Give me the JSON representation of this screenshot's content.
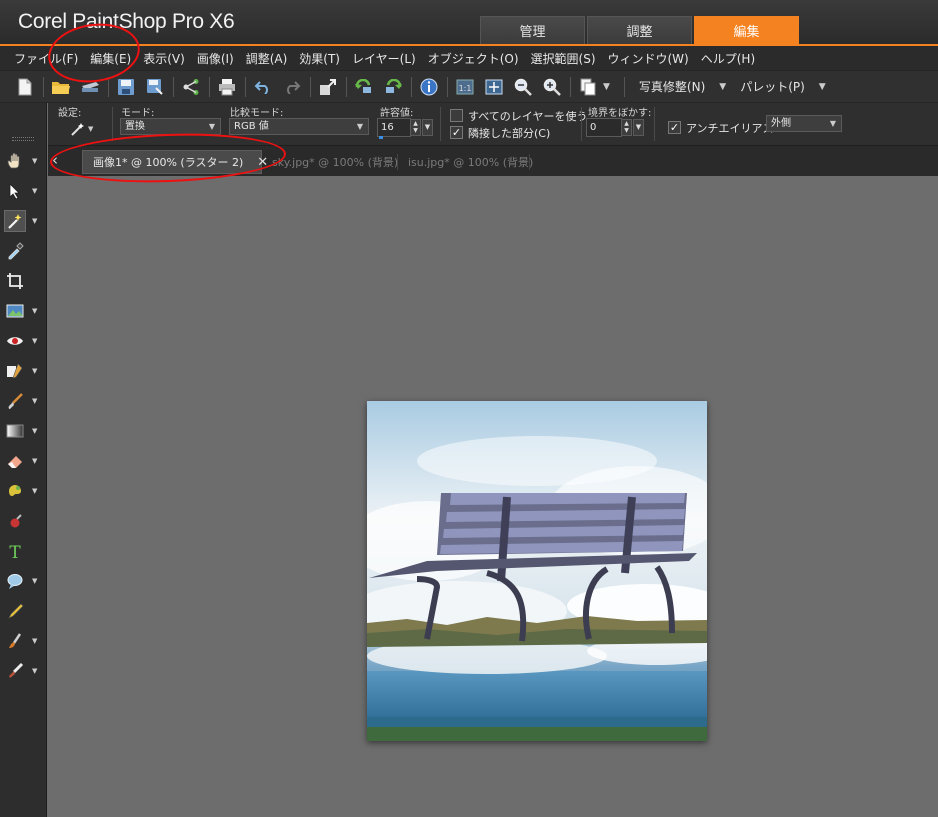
{
  "app": {
    "title": "Corel PaintShop Pro X6"
  },
  "workspace_tabs": [
    {
      "label": "管理"
    },
    {
      "label": "調整"
    },
    {
      "label": "編集"
    }
  ],
  "menu": [
    {
      "label": "ファイル(F)"
    },
    {
      "label": "編集(E)"
    },
    {
      "label": "表示(V)"
    },
    {
      "label": "画像(I)"
    },
    {
      "label": "調整(A)"
    },
    {
      "label": "効果(T)"
    },
    {
      "label": "レイヤー(L)"
    },
    {
      "label": "オブジェクト(O)"
    },
    {
      "label": "選択範囲(S)"
    },
    {
      "label": "ウィンドウ(W)"
    },
    {
      "label": "ヘルプ(H)"
    }
  ],
  "toolbar": {
    "photo_fix_label": "写真修整(N)",
    "palette_label": "パレット(P)"
  },
  "options": {
    "preset_label": "設定:",
    "mode_label": "モード:",
    "mode_value": "置換",
    "match_mode_label": "比較モード:",
    "match_mode_value": "RGB 値",
    "tolerance_label": "許容値:",
    "tolerance_value": "16",
    "use_all_layers_label": "すべてのレイヤーを使う",
    "use_all_layers_checked": false,
    "contiguous_label": "隣接した部分(C)",
    "contiguous_checked": true,
    "feather_label": "境界をぼかす:",
    "feather_value": "0",
    "antialias_label": "アンチエイリアス",
    "antialias_checked": true,
    "antialias_mode_value": "外側"
  },
  "document_tabs": [
    {
      "label": "画像1* @ 100% (ラスター 2)",
      "active": true
    },
    {
      "label": "sky.jpg* @ 100% (背景)",
      "active": false
    },
    {
      "label": "isu.jpg* @ 100% (背景)",
      "active": false
    }
  ],
  "colors": {
    "accent": "#f58220",
    "annotation": "#e11111"
  },
  "tools": [
    {
      "icon": "pan-hand-icon"
    },
    {
      "icon": "pick-arrow-icon"
    },
    {
      "icon": "magic-wand-icon"
    },
    {
      "icon": "dropper-icon"
    },
    {
      "icon": "crop-icon"
    },
    {
      "icon": "straighten-icon"
    },
    {
      "icon": "red-eye-icon"
    },
    {
      "icon": "clone-icon"
    },
    {
      "icon": "paint-brush-icon"
    },
    {
      "icon": "gradient-fill-icon"
    },
    {
      "icon": "eraser-icon"
    },
    {
      "icon": "picture-tube-icon"
    },
    {
      "icon": "color-changer-icon"
    },
    {
      "icon": "text-tool-icon"
    },
    {
      "icon": "preset-shape-icon"
    },
    {
      "icon": "pen-tool-icon"
    },
    {
      "icon": "warp-brush-icon"
    },
    {
      "icon": "smudge-icon"
    }
  ]
}
